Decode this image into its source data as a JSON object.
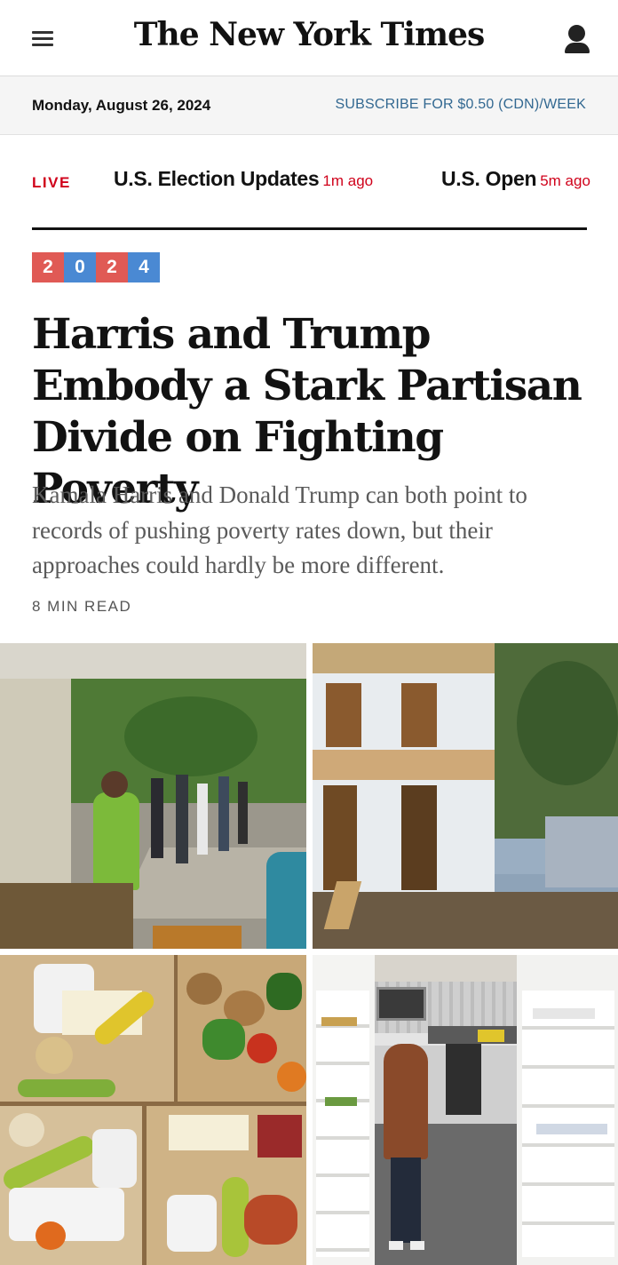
{
  "header": {
    "logo": "The New York Times",
    "menu_icon": "hamburger-menu-icon",
    "account_icon": "account-icon"
  },
  "datebar": {
    "date": "Monday, August 26, 2024",
    "subscribe": "SUBSCRIBE FOR $0.50 (CDN)/WEEK"
  },
  "live_strip": {
    "live_label": "LIVE",
    "items": [
      {
        "title": "U.S. Election Updates",
        "ago": "1m ago"
      },
      {
        "title": "U.S. Open",
        "ago": "5m ago"
      }
    ]
  },
  "article": {
    "badge": [
      "2",
      "0",
      "2",
      "4"
    ],
    "headline": "Harris and Trump Embody a Stark Partisan Divide on Fighting Poverty",
    "summary": "Kamala Harris and Donald Trump can both point to records of pushing poverty rates down, but their approaches could hardly be more different.",
    "read_time": "8 MIN READ"
  },
  "photos": [
    {
      "name": "food-distribution-photo"
    },
    {
      "name": "house-construction-photo"
    },
    {
      "name": "grocery-boxes-photo"
    },
    {
      "name": "pharmacy-photo"
    }
  ],
  "colors": {
    "live_red": "#d0021b",
    "subscribe_blue": "#326891",
    "badge_red": "#e05a55",
    "badge_blue": "#4a89d3"
  }
}
